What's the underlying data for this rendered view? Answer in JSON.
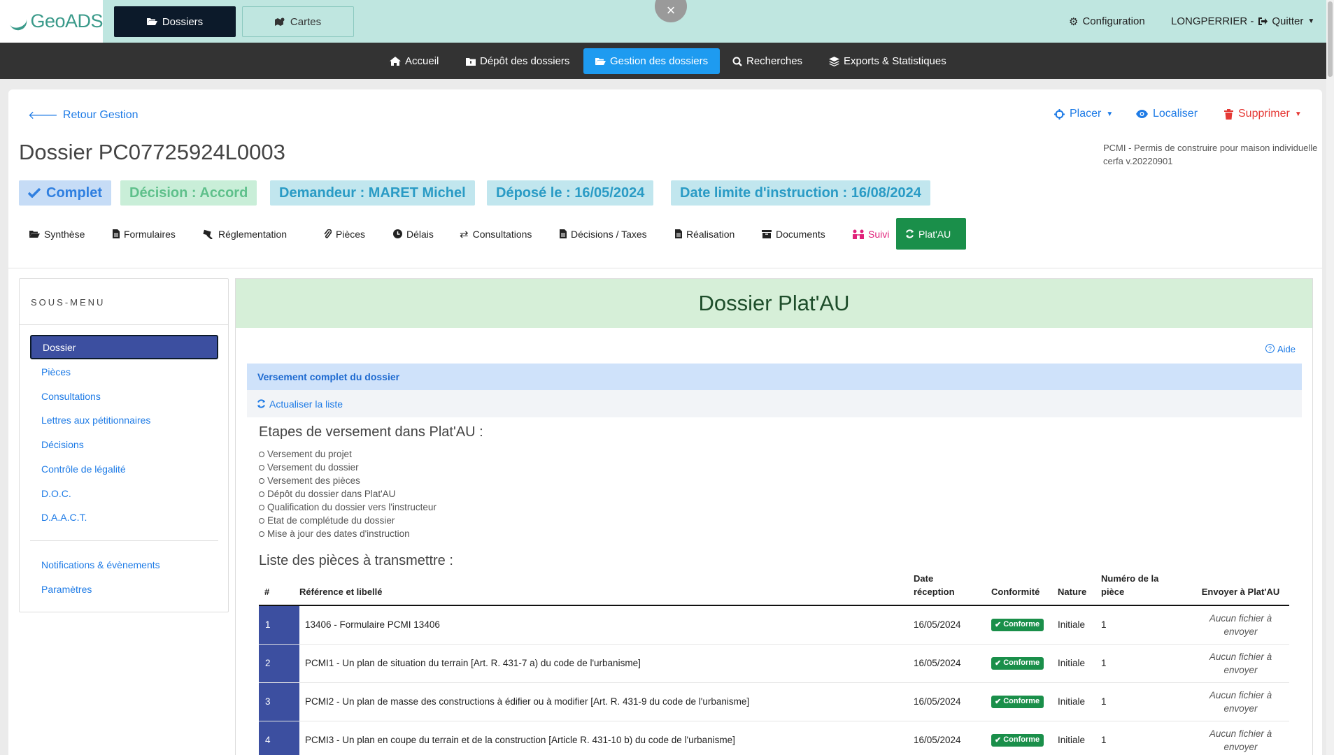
{
  "app": {
    "logo": "GeoADS"
  },
  "topbar": {
    "btn_dossiers": "Dossiers",
    "btn_cartes": "Cartes",
    "close": "×",
    "configuration": "Configuration",
    "user": "LONGPERRIER -",
    "quit": "Quitter"
  },
  "mainnav": {
    "items": [
      "Accueil",
      "Dépôt des dossiers",
      "Gestion des dossiers",
      "Recherches",
      "Exports & Statistiques"
    ]
  },
  "header": {
    "back": "Retour Gestion",
    "placer": "Placer",
    "localiser": "Localiser",
    "supprimer": "Supprimer",
    "title": "Dossier PC07725924L0003",
    "type_line1": "PCMI - Permis de construire pour maison individuelle",
    "type_line2": "cerfa v.20220901"
  },
  "badges": {
    "complet": "Complet",
    "decision": "Décision : Accord",
    "demandeur": "Demandeur : MARET Michel",
    "depose": "Déposé le : 16/05/2024",
    "limite": "Date limite d'instruction : 16/08/2024"
  },
  "tabs": [
    "Synthèse",
    "Formulaires",
    "Réglementation",
    "Pièces",
    "Délais",
    "Consultations",
    "Décisions / Taxes",
    "Réalisation",
    "Documents",
    "Suivi",
    "Plat'AU"
  ],
  "sidebar": {
    "title": "SOUS-MENU",
    "items": [
      "Dossier",
      "Pièces",
      "Consultations",
      "Lettres aux pétitionnaires",
      "Décisions",
      "Contrôle de légalité",
      "D.O.C.",
      "D.A.A.C.T."
    ],
    "items2": [
      "Notifications & évènements",
      "Paramètres"
    ]
  },
  "content": {
    "title": "Dossier Plat'AU",
    "aide": "Aide",
    "panel_title": "Versement complet du dossier",
    "refresh": "Actualiser la liste",
    "steps_title": "Etapes de versement dans Plat'AU :",
    "steps": [
      "Versement du projet",
      "Versement du dossier",
      "Versement des pièces",
      "Dépôt du dossier dans Plat'AU",
      "Qualification du dossier vers l'instructeur",
      "Etat de complétude du dossier",
      "Mise à jour des dates d'instruction"
    ],
    "list_title": "Liste des pièces à transmettre :"
  },
  "table": {
    "headers": {
      "num": "#",
      "ref": "Référence et libellé",
      "date1": "Date",
      "date2": "réception",
      "conf": "Conformité",
      "nature": "Nature",
      "numero1": "Numéro de la",
      "numero2": "pièce",
      "envoyer": "Envoyer à Plat'AU"
    },
    "rows": [
      {
        "num": "1",
        "ref": "13406 - Formulaire PCMI 13406",
        "date": "16/05/2024",
        "conf": "Conforme",
        "nature": "Initiale",
        "numero": "1",
        "env1": "Aucun fichier à",
        "env2": "envoyer"
      },
      {
        "num": "2",
        "ref": "PCMI1 - Un plan de situation du terrain [Art. R. 431-7 a) du code de l'urbanisme]",
        "date": "16/05/2024",
        "conf": "Conforme",
        "nature": "Initiale",
        "numero": "1",
        "env1": "Aucun fichier à",
        "env2": "envoyer"
      },
      {
        "num": "3",
        "ref": "PCMI2 - Un plan de masse des constructions à édifier ou à modifier [Art. R. 431-9 du code de l'urbanisme]",
        "date": "16/05/2024",
        "conf": "Conforme",
        "nature": "Initiale",
        "numero": "1",
        "env1": "Aucun fichier à",
        "env2": "envoyer"
      },
      {
        "num": "4",
        "ref": "PCMI3 - Un plan en coupe du terrain et de la construction [Article R. 431-10 b) du code de l'urbanisme]",
        "date": "16/05/2024",
        "conf": "Conforme",
        "nature": "Initiale",
        "numero": "1",
        "env1": "Aucun fichier à",
        "env2": "envoyer"
      }
    ]
  },
  "colors": {
    "accent": "#1e9bf0",
    "brand": "#3a9a8a",
    "active_tab": "#1a8f4a",
    "sidebar_active": "#3c4fa0",
    "danger": "#e53935"
  }
}
